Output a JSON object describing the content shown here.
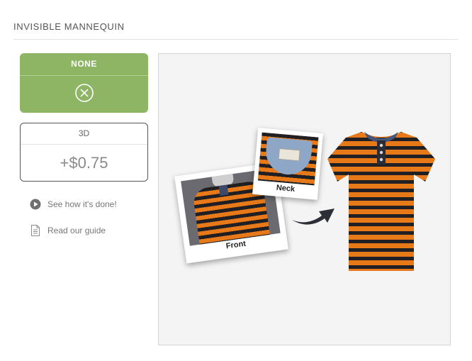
{
  "section": {
    "title": "INVISIBLE MANNEQUIN"
  },
  "options": [
    {
      "label": "NONE",
      "icon": "close-circle-icon",
      "selected": true
    },
    {
      "label": "3D",
      "price": "+$0.75",
      "selected": false
    }
  ],
  "links": [
    {
      "label": "See how it's done!",
      "icon": "play-circle-icon"
    },
    {
      "label": "Read our guide",
      "icon": "document-icon"
    }
  ],
  "preview": {
    "front_caption": "Front",
    "neck_caption": "Neck"
  },
  "colors": {
    "selected_bg": "#8db564",
    "stripe_orange": "#e77918",
    "stripe_dark": "#1f1f24"
  }
}
